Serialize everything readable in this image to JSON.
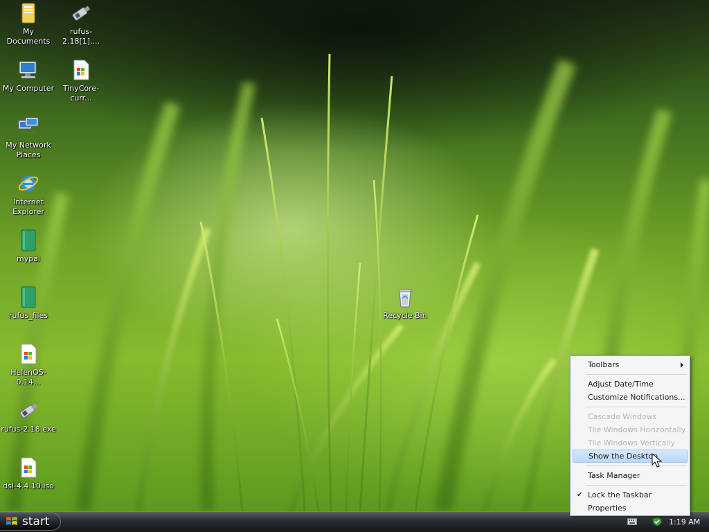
{
  "desktop": {
    "icons": [
      {
        "label": "My Documents",
        "icon": "folder-documents-icon"
      },
      {
        "label": "rufus-2.18[1]....",
        "icon": "usb-drive-icon"
      },
      {
        "label": "My Computer",
        "icon": "computer-icon"
      },
      {
        "label": "TinyCore-curr...",
        "icon": "disc-image-file-icon"
      },
      {
        "label": "My Network Places",
        "icon": "network-places-icon"
      },
      {
        "label": "Internet Explorer",
        "icon": "internet-explorer-icon"
      },
      {
        "label": "mypal",
        "icon": "green-folder-icon"
      },
      {
        "label": "rufus_files",
        "icon": "green-folder-icon"
      },
      {
        "label": "HelenOS-0.14...",
        "icon": "disc-image-file-icon"
      },
      {
        "label": "rufus-2.18.exe",
        "icon": "usb-drive-icon"
      },
      {
        "label": "dsl-4.4.10.iso",
        "icon": "disc-image-file-icon"
      },
      {
        "label": "Recycle Bin",
        "icon": "recycle-bin-icon"
      }
    ]
  },
  "taskbar": {
    "start_label": "start",
    "clock": "1:19 AM"
  },
  "context_menu": {
    "toolbars": "Toolbars",
    "adjust_datetime": "Adjust Date/Time",
    "customize_notifications": "Customize Notifications...",
    "cascade_windows": "Cascade Windows",
    "tile_horizontally": "Tile Windows Horizontally",
    "tile_vertically": "Tile Windows Vertically",
    "show_desktop": "Show the Desktop",
    "task_manager": "Task Manager",
    "lock_taskbar": "Lock the Taskbar",
    "properties": "Properties"
  },
  "colors": {
    "menu_highlight": "#bcd8f6",
    "menu_disabled_text": "#b4b6ba",
    "taskbar_dark": "#15171a"
  }
}
